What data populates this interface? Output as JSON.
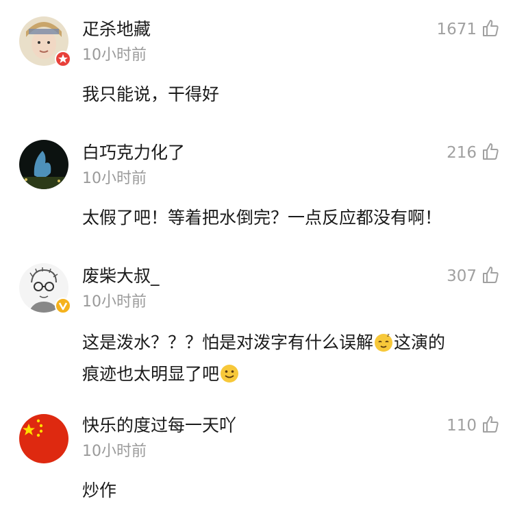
{
  "comments": [
    {
      "username": "疋杀地藏",
      "time": "10小时前",
      "likes": "1671",
      "text": "我只能说，干得好",
      "badge": "red-star-badge"
    },
    {
      "username": "白巧克力化了",
      "time": "10小时前",
      "likes": "216",
      "text": "太假了吧！等着把水倒完？一点反应都没有啊！"
    },
    {
      "username": "废柴大叔_",
      "time": "10小时前",
      "likes": "307",
      "text_line1": "这是泼水？？？怕是对泼字有什么误解",
      "text_line1_tail": "这演的",
      "text_line2": "痕迹也太明显了吧",
      "badge": "yellow-v-badge"
    },
    {
      "username": "快乐的度过每一天吖",
      "time": "10小时前",
      "likes": "110",
      "text": "炒作"
    }
  ],
  "colors": {
    "text": "#1a1a1a",
    "meta": "#9a9a9a",
    "red_badge": "#e8403a",
    "yellow_badge": "#f5b21c"
  },
  "icons": [
    "thumbs-up-icon",
    "sleepy-face-emoji",
    "smile-emoji"
  ]
}
